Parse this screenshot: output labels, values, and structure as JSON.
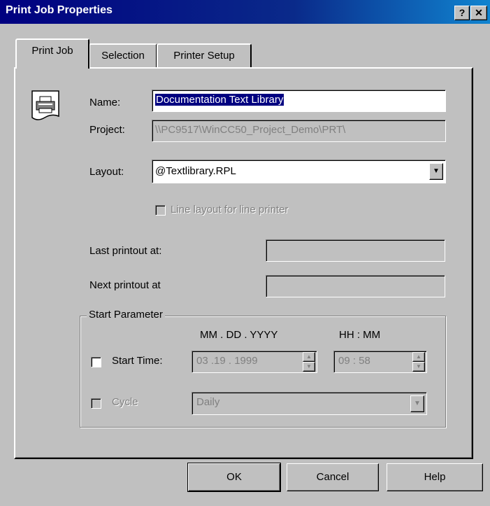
{
  "window": {
    "title": "Print Job Properties",
    "help_glyph": "?",
    "close_glyph": "✕"
  },
  "tabs": [
    "Print Job",
    "Selection",
    "Printer Setup"
  ],
  "fields": {
    "name_label": "Name:",
    "name_value": "Documentation Text Library",
    "project_label": "Project:",
    "project_value": "\\\\PC9517\\WinCC50_Project_Demo\\PRT\\",
    "layout_label": "Layout:",
    "layout_value": "@Textlibrary.RPL",
    "line_layout_label": "Line layout for line printer",
    "last_printout_label": "Last printout at:",
    "next_printout_label": "Next printout at"
  },
  "start_parameter": {
    "group_label": "Start Parameter",
    "date_format": "MM . DD . YYYY",
    "time_format": "HH : MM",
    "start_time_label": "Start Time:",
    "date_value": "03  .19  . 1999",
    "time_value": "09   : 58",
    "cycle_label": "Cycle",
    "cycle_value": "Daily"
  },
  "buttons": {
    "ok": "OK",
    "cancel": "Cancel",
    "help": "Help"
  }
}
